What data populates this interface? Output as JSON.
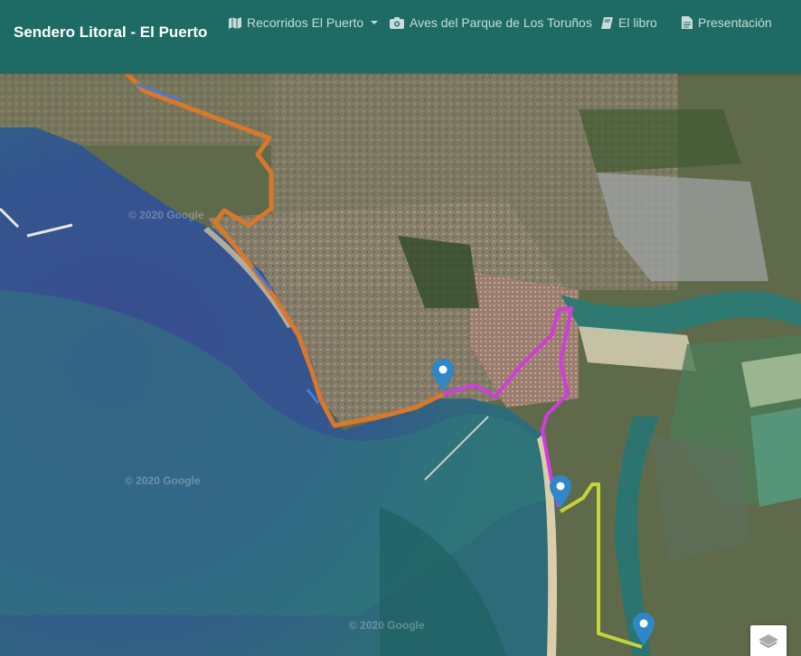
{
  "navbar": {
    "brand": "Sendero Litoral - El Puerto",
    "items": [
      {
        "label": "Recorridos El Puerto",
        "icon": "map-icon",
        "dropdown": true
      },
      {
        "label": "Aves del Parque de Los Toruños",
        "icon": "camera-icon"
      },
      {
        "label": "El libro",
        "icon": "book-icon"
      },
      {
        "label": "Presentación",
        "icon": "document-icon"
      }
    ]
  },
  "map": {
    "watermarks": [
      "© 2020 Google",
      "© 2020 Google",
      "© 2020 Google"
    ],
    "routes": [
      {
        "color": "#d9782a"
      },
      {
        "color": "#4a7bd0"
      },
      {
        "color": "#d23be0"
      },
      {
        "color": "#c5d43a"
      }
    ],
    "marker_color": "#2f86c8",
    "layer_control_icon": "layers-icon"
  }
}
